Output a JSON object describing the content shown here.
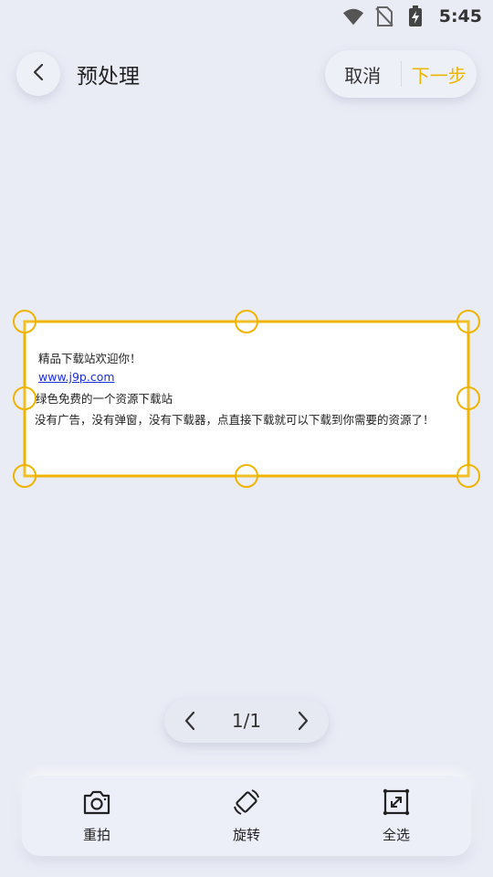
{
  "status_bar": {
    "time": "5:45",
    "icons": [
      "wifi-icon",
      "no-sim-icon",
      "battery-charging-icon"
    ]
  },
  "header": {
    "back_icon": "chevron-left-icon",
    "title": "预处理",
    "cancel_label": "取消",
    "next_label": "下一步"
  },
  "colors": {
    "background": "#e9ebf5",
    "accent": "#f0b400",
    "link": "#1f2fd6"
  },
  "document": {
    "lines": [
      "精品下载站欢迎你！",
      "www.j9p.com",
      "绿色免费的一个资源下载站",
      "没有广告，没有弹窗，没有下载器，点直接下载就可以下载到你需要的资源了！"
    ]
  },
  "pager": {
    "prev_icon": "chevron-left-icon",
    "indicator": "1/1",
    "next_icon": "chevron-right-icon"
  },
  "toolbar": {
    "retake_label": "重拍",
    "rotate_label": "旋转",
    "select_all_label": "全选",
    "retake_icon": "camera-icon",
    "rotate_icon": "rotate-icon",
    "select_all_icon": "expand-icon"
  }
}
